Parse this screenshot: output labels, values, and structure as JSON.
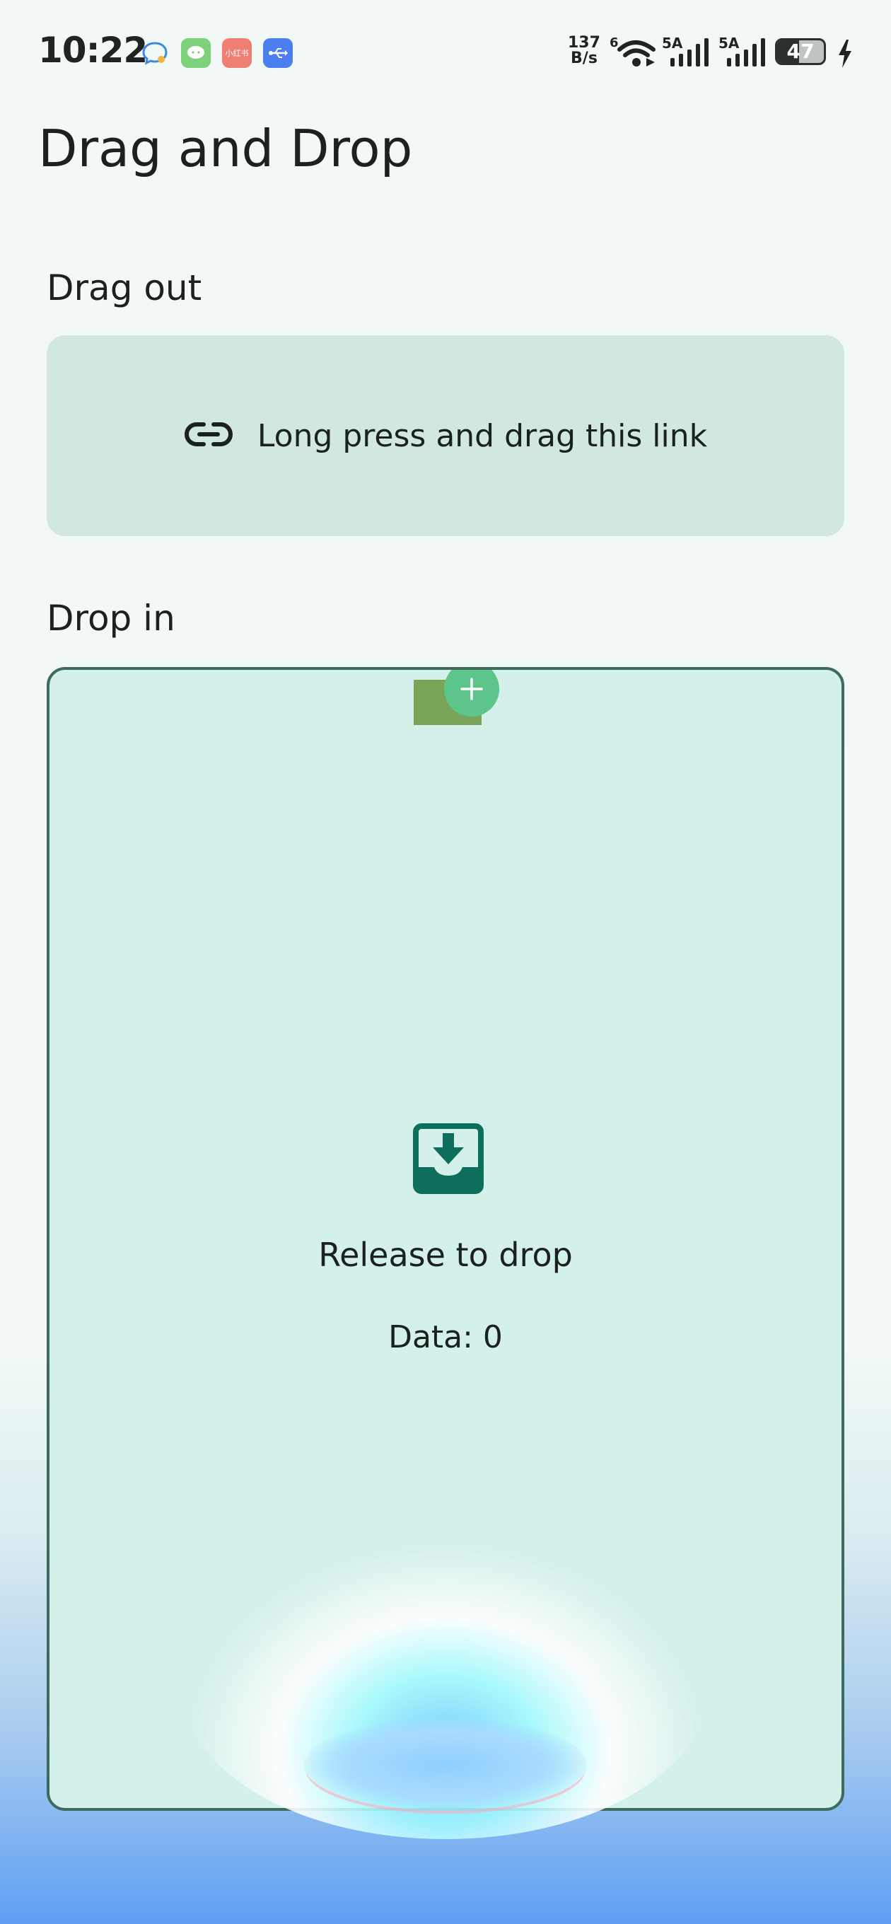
{
  "status_bar": {
    "time": "10:22",
    "net_speed_value": "137",
    "net_speed_unit": "B/s",
    "wifi_label": "6",
    "signal1_label": "5A",
    "signal2_label": "5A",
    "battery_level": "47",
    "app_icons": [
      "chat-bubble-icon",
      "wechat-icon",
      "xiaohongshu-icon",
      "usb-icon"
    ],
    "xhs_text": "小红书"
  },
  "page": {
    "title": "Drag and Drop"
  },
  "drag_out": {
    "label": "Drag out",
    "card_text": "Long press and drag this link",
    "icon": "link-icon"
  },
  "drop_in": {
    "label": "Drop in",
    "release_text": "Release to drop",
    "data_text": "Data: 0",
    "icon": "inbox-download-icon",
    "drag_badge_icon": "plus-icon"
  },
  "colors": {
    "card_bg": "#d1e7e1",
    "drop_bg": "#d3f0ea",
    "drop_border": "#3f6a5f",
    "accent_icon": "#0e6e5c",
    "plus_badge": "#5cc58a",
    "drag_thumb": "#7aa457"
  }
}
